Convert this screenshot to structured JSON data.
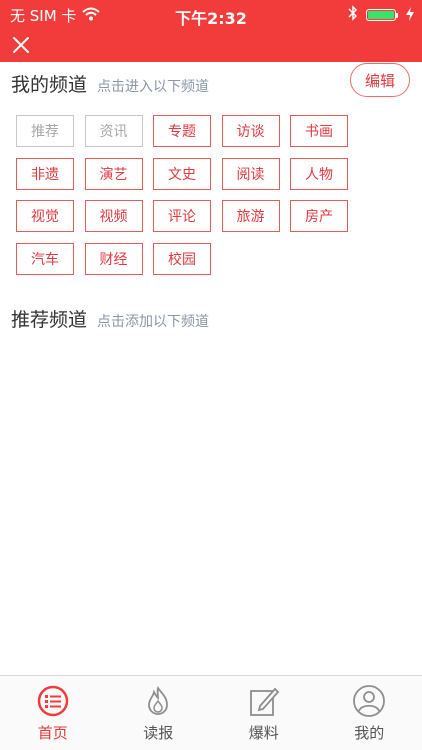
{
  "status": {
    "carrier": "无 SIM 卡",
    "time": "下午2:32",
    "battery_level": 1.0
  },
  "my_channels": {
    "title": "我的频道",
    "hint": "点击进入以下频道",
    "edit_label": "编辑",
    "items": [
      {
        "label": "推荐",
        "fixed": true
      },
      {
        "label": "资讯",
        "fixed": true
      },
      {
        "label": "专题",
        "fixed": false
      },
      {
        "label": "访谈",
        "fixed": false
      },
      {
        "label": "书画",
        "fixed": false
      },
      {
        "label": "非遗",
        "fixed": false
      },
      {
        "label": "演艺",
        "fixed": false
      },
      {
        "label": "文史",
        "fixed": false
      },
      {
        "label": "阅读",
        "fixed": false
      },
      {
        "label": "人物",
        "fixed": false
      },
      {
        "label": "视觉",
        "fixed": false
      },
      {
        "label": "视频",
        "fixed": false
      },
      {
        "label": "评论",
        "fixed": false
      },
      {
        "label": "旅游",
        "fixed": false
      },
      {
        "label": "房产",
        "fixed": false
      },
      {
        "label": "汽车",
        "fixed": false
      },
      {
        "label": "财经",
        "fixed": false
      },
      {
        "label": "校园",
        "fixed": false
      }
    ]
  },
  "recommended": {
    "title": "推荐频道",
    "hint": "点击添加以下频道"
  },
  "tabbar": {
    "items": [
      {
        "label": "首页",
        "icon": "list-circle-icon",
        "active": true
      },
      {
        "label": "读报",
        "icon": "flame-icon",
        "active": false
      },
      {
        "label": "爆料",
        "icon": "edit-note-icon",
        "active": false
      },
      {
        "label": "我的",
        "icon": "user-profile-icon",
        "active": false
      }
    ]
  },
  "colors": {
    "brand_red": "#f23c3c",
    "tag_red": "#e0393e",
    "tag_fixed_gray": "#a7a7a7",
    "hint_gray": "#8a97a6",
    "battery_green": "#39e26a"
  }
}
